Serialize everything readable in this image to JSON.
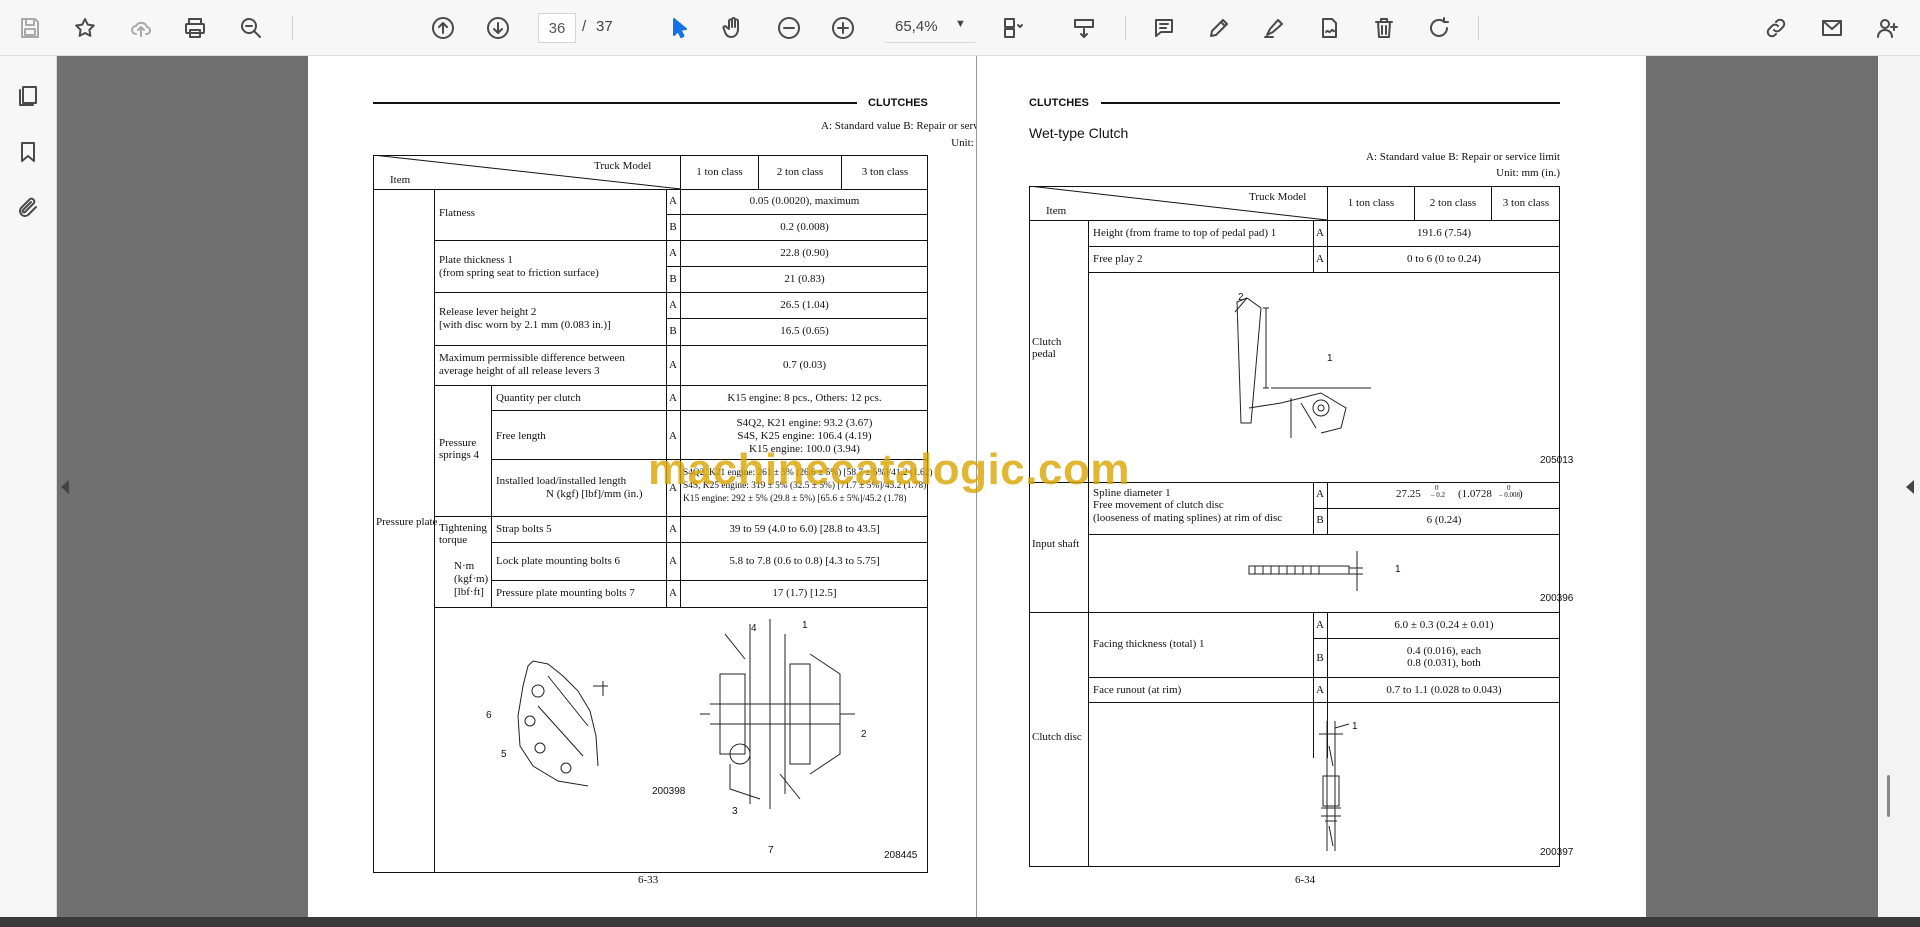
{
  "toolbar": {
    "page_current": "36",
    "page_separator": "/",
    "page_total": "37",
    "zoom": "65,4%",
    "icons": [
      "save-icon",
      "bookmark-star-icon",
      "cloud-upload-icon",
      "print-icon",
      "find-zoom-icon",
      "page-up-icon",
      "page-down-icon",
      "select-pointer-icon",
      "hand-pan-icon",
      "zoom-out-icon",
      "zoom-in-icon",
      "page-layout-icon",
      "scroll-mode-icon",
      "comment-icon",
      "pencil-icon",
      "highlighter-icon",
      "sign-icon",
      "delete-icon",
      "rotate-icon",
      "share-link-icon",
      "email-icon",
      "add-user-icon"
    ]
  },
  "sidebar": {
    "icons": [
      "pages-icon",
      "bookmarks-icon",
      "attachments-icon"
    ]
  },
  "watermark": "machinecatalogic.com",
  "left_page": {
    "header": "CLUTCHES",
    "legend": "A:  Standard value     B:  Repair or service limit",
    "unit": "Unit:  mm (in.)",
    "head_truck": "Truck  Model",
    "head_item": "Item",
    "classes": [
      "1 ton class",
      "2 ton class",
      "3 ton class"
    ],
    "group_pressure_plate": "Pressure plate",
    "flatness": "Flatness",
    "flat_a": "0.05 (0.0020), maximum",
    "flat_b": "0.2 (0.008)",
    "plate_thick_1": "Plate thickness 1",
    "plate_thick_2": "(from spring seat to friction surface)",
    "plate_a": "22.8 (0.90)",
    "plate_b": "21 (0.83)",
    "release_1": "Release lever height 2",
    "release_2": "[with disc worn by 2.1 mm (0.083 in.)]",
    "release_a": "26.5 (1.04)",
    "release_b": "16.5 (0.65)",
    "maxdiff_1": "Maximum permissible difference between",
    "maxdiff_2": "average height of all release levers 3",
    "maxdiff_a": "0.7 (0.03)",
    "springs_1": "Pressure",
    "springs_2": "springs 4",
    "qty": "Quantity per clutch",
    "qty_a": "K15 engine: 8 pcs., Others: 12 pcs.",
    "free_len": "Free length",
    "free_a1": "S4Q2, K21 engine: 93.2 (3.67)",
    "free_a2": "S4S, K25 engine: 106.4 (4.19)",
    "free_a3": "K15 engine: 100.0 (3.94)",
    "load_1": "Installed load/installed length",
    "load_2": "N (kgf) [lbf]/mm (in.)",
    "load_a1": "S4Q2, K21 engine: 261 ± 5% (26.6 ± 5%) [58.7 ± 5%]/41.2 (1.62)",
    "load_a2": "S4S, K25 engine: 319 ± 5% (32.5 ± 5%) [71.7 ± 5%]/45.2 (1.78)",
    "load_a3": "K15 engine: 292 ± 5% (29.8 ± 5%) [65.6 ± 5%]/45.2 (1.78)",
    "torque_1": "Tightening",
    "torque_2": "torque",
    "torque_u1": "N·m",
    "torque_u2": "(kgf·m)",
    "torque_u3": "[lbf·ft]",
    "strap": "Strap bolts 5",
    "strap_a": "39 to 59 (4.0 to 6.0) [28.8 to 43.5]",
    "lockplate": "Lock plate mounting bolts 6",
    "lockplate_a": "5.8 to 7.8 (0.6 to 0.8) [4.3 to 5.75]",
    "ppbolts": "Pressure plate mounting bolts 7",
    "ppbolts_a": "17 (1.7) [12.5]",
    "fig1_id": "200398",
    "fig2_id": "208445",
    "callouts": [
      "6",
      "5",
      "4",
      "1",
      "2",
      "3",
      "7"
    ],
    "page_no": "6-33"
  },
  "right_page": {
    "header": "CLUTCHES",
    "title": "Wet-type Clutch",
    "legend": "A:  Standard value     B:  Repair or service limit",
    "unit": "Unit:  mm (in.)",
    "head_truck": "Truck  Model",
    "head_item": "Item",
    "classes": [
      "1 ton class",
      "2 ton class",
      "3 ton class"
    ],
    "pedal_1": "Clutch",
    "pedal_2": "pedal",
    "height": "Height (from frame to top of pedal pad) 1",
    "height_a": "191.6 (7.54)",
    "freeplay": "Free play 2",
    "freeplay_a": "0 to 6 (0 to 0.24)",
    "fig_pedal": "205013",
    "input_shaft": "Input shaft",
    "spline_1": "Spline diameter 1",
    "spline_2": "Free movement of clutch disc",
    "spline_3": "(looseness of mating splines) at rim of disc",
    "spline_a_main": "27.25",
    "spline_a_tol_top": "0",
    "spline_a_tol_bot": "– 0.2",
    "spline_a_in": "(1.0728",
    "spline_a_in_top": "0",
    "spline_a_in_bot": "– 0.008",
    "spline_a_close": ")",
    "spline_b": "6 (0.24)",
    "fig_shaft": "200396",
    "clutch_disc": "Clutch disc",
    "facing": "Facing thickness (total) 1",
    "facing_a": "6.0 ± 0.3 (0.24 ± 0.01)",
    "facing_b1": "0.4 (0.016), each",
    "facing_b2": "0.8 (0.031), both",
    "runout": "Face runout (at rim)",
    "runout_a": "0.7 to 1.1 (0.028 to 0.043)",
    "fig_disc": "200397",
    "callouts": [
      "2",
      "1",
      "1",
      "1"
    ],
    "page_no": "6-34"
  },
  "ab": {
    "a": "A",
    "b": "B"
  }
}
